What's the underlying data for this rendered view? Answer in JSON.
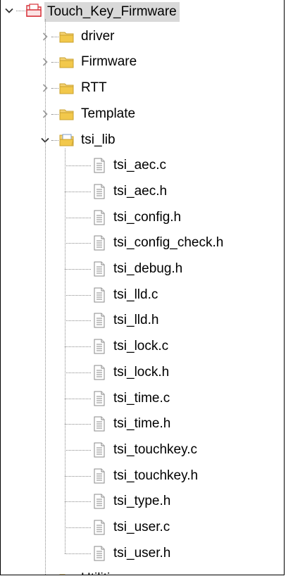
{
  "root": {
    "label": "Touch_Key_Firmware",
    "expanded": true,
    "selected": true
  },
  "folders_before": [
    {
      "label": "driver",
      "expanded": false
    },
    {
      "label": "Firmware",
      "expanded": false
    },
    {
      "label": "RTT",
      "expanded": false
    },
    {
      "label": "Template",
      "expanded": false
    }
  ],
  "tsi_lib": {
    "label": "tsi_lib",
    "expanded": true,
    "files": [
      {
        "label": "tsi_aec.c"
      },
      {
        "label": "tsi_aec.h"
      },
      {
        "label": "tsi_config.h"
      },
      {
        "label": "tsi_config_check.h"
      },
      {
        "label": "tsi_debug.h"
      },
      {
        "label": "tsi_lld.c"
      },
      {
        "label": "tsi_lld.h"
      },
      {
        "label": "tsi_lock.c"
      },
      {
        "label": "tsi_lock.h"
      },
      {
        "label": "tsi_time.c"
      },
      {
        "label": "tsi_time.h"
      },
      {
        "label": "tsi_touchkey.c"
      },
      {
        "label": "tsi_touchkey.h"
      },
      {
        "label": "tsi_type.h"
      },
      {
        "label": "tsi_user.c"
      },
      {
        "label": "tsi_user.h"
      }
    ]
  },
  "folders_after": [
    {
      "label": "Utilities",
      "expanded": false
    }
  ],
  "icons": {
    "project": "project-icon",
    "folder": "folder-icon",
    "open_folder": "open-folder-icon",
    "file": "file-icon",
    "expand": "chevron-down-icon",
    "collapse": "chevron-right-icon"
  },
  "colors": {
    "selection": "#d9d9d9",
    "folder": "#f2c84b",
    "project_red": "#d7323a",
    "tree_lines": "#8a8a8a"
  }
}
